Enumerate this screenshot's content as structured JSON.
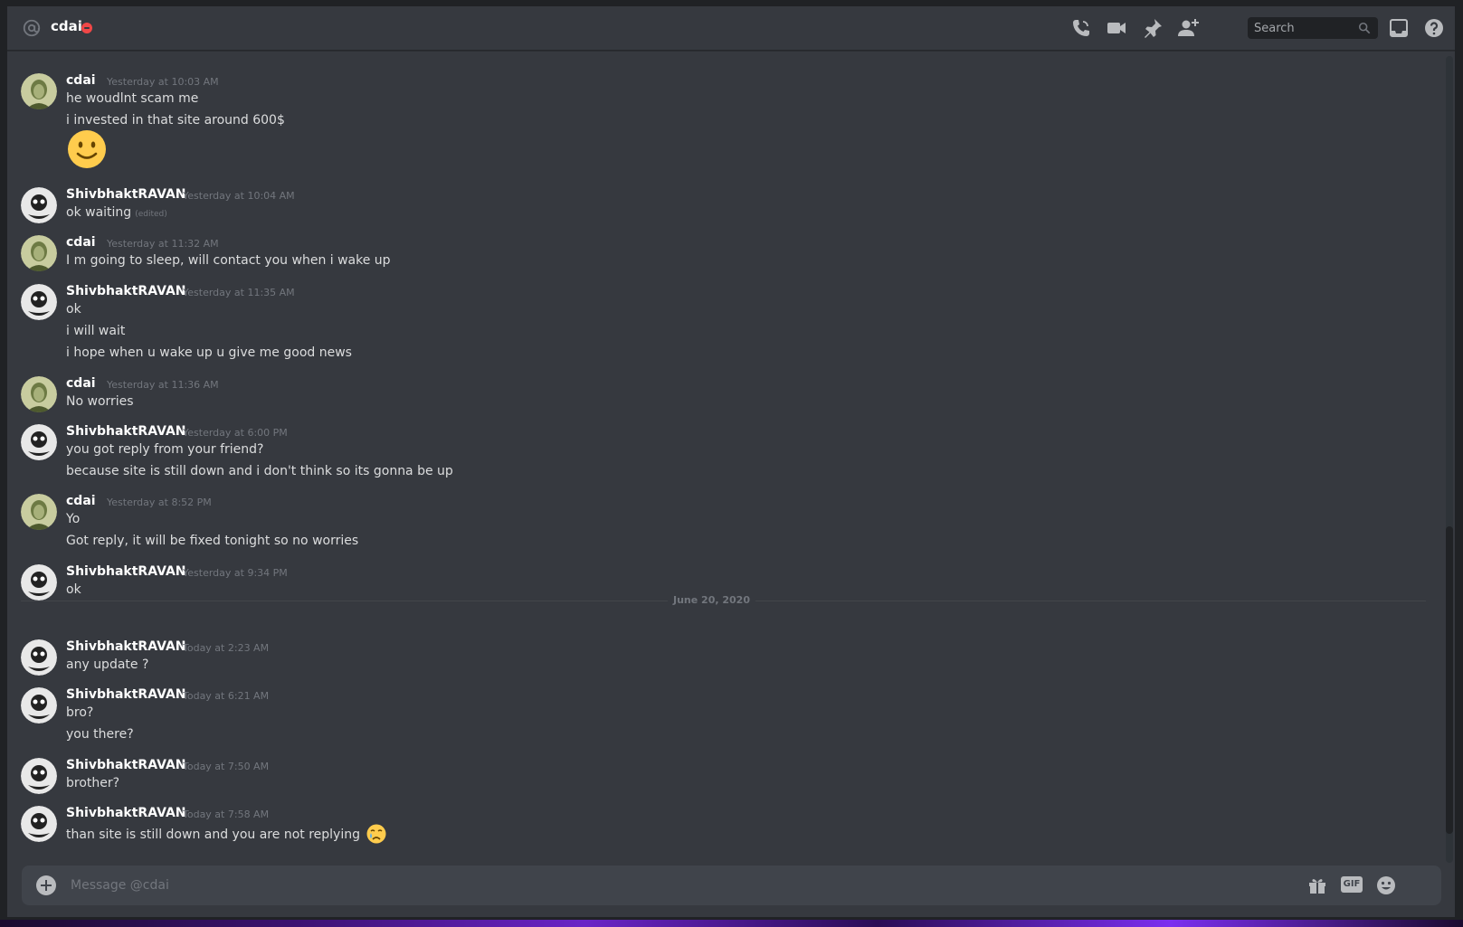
{
  "header": {
    "dm_name": "cdai",
    "search_placeholder": "Search",
    "icons": [
      "at-icon",
      "dnd-status-icon",
      "voice-call-icon",
      "video-call-icon",
      "pin-icon",
      "add-friend-icon",
      "search-icon",
      "inbox-icon",
      "help-icon"
    ]
  },
  "messages": {
    "groups": [
      {
        "author": "cdai",
        "avatar": "cdai-avatar",
        "timestamp": "Yesterday at 10:03 AM",
        "lines": [
          "he woudlnt scam me",
          "i invested in that site around 600$"
        ],
        "emoji": "slightly-smiling-face"
      },
      {
        "author": "ShivbhaktRAVAN",
        "avatar": "ravan-avatar",
        "timestamp": "Yesterday at 10:04 AM",
        "lines": [
          "ok waiting"
        ],
        "edited": "(edited)"
      },
      {
        "author": "cdai",
        "avatar": "cdai-avatar",
        "timestamp": "Yesterday at 11:32 AM",
        "lines": [
          "I m going to sleep, will contact you when i wake up"
        ]
      },
      {
        "author": "ShivbhaktRAVAN",
        "avatar": "ravan-avatar",
        "timestamp": "Yesterday at 11:35 AM",
        "lines": [
          "ok",
          "i will wait",
          "i hope when u wake up u give me good news"
        ]
      },
      {
        "author": "cdai",
        "avatar": "cdai-avatar",
        "timestamp": "Yesterday at 11:36 AM",
        "lines": [
          "No worries"
        ]
      },
      {
        "author": "ShivbhaktRAVAN",
        "avatar": "ravan-avatar",
        "timestamp": "Yesterday at 6:00 PM",
        "lines": [
          "you got reply from your friend?",
          "because site is still down and i don't think so its gonna be up"
        ]
      },
      {
        "author": "cdai",
        "avatar": "cdai-avatar",
        "timestamp": "Yesterday at 8:52 PM",
        "lines": [
          "Yo",
          "Got reply, it will be fixed tonight so no worries"
        ]
      },
      {
        "author": "ShivbhaktRAVAN",
        "avatar": "ravan-avatar",
        "timestamp": "Yesterday at 9:34 PM",
        "lines": [
          "ok"
        ]
      },
      {
        "author": "ShivbhaktRAVAN",
        "avatar": "ravan-avatar",
        "timestamp": "Today at 2:23 AM",
        "lines": [
          "any update ?"
        ]
      },
      {
        "author": "ShivbhaktRAVAN",
        "avatar": "ravan-avatar",
        "timestamp": "Today at 6:21 AM",
        "lines": [
          "bro?",
          "you there?"
        ]
      },
      {
        "author": "ShivbhaktRAVAN",
        "avatar": "ravan-avatar",
        "timestamp": "Today at 7:50 AM",
        "lines": [
          "brother?"
        ]
      },
      {
        "author": "ShivbhaktRAVAN",
        "avatar": "ravan-avatar",
        "timestamp": "Today at 7:58 AM",
        "lines": [
          "than site is still down and you are not replying"
        ],
        "emoji": "crying-face"
      }
    ],
    "date_divider": "June 20, 2020"
  },
  "composer": {
    "placeholder": "Message @cdai",
    "gif_label": "GIF",
    "icons": [
      "attach-plus-icon",
      "gift-icon",
      "gif-icon",
      "emoji-picker-icon"
    ]
  },
  "colors": {
    "background": "#36393f",
    "header_text": "#ffffff",
    "message_text": "#dcddde",
    "timestamp": "#72767d",
    "dnd_red": "#f04747",
    "composer_bg": "#40444b",
    "emoji_yellow": "#ffcc4d"
  }
}
